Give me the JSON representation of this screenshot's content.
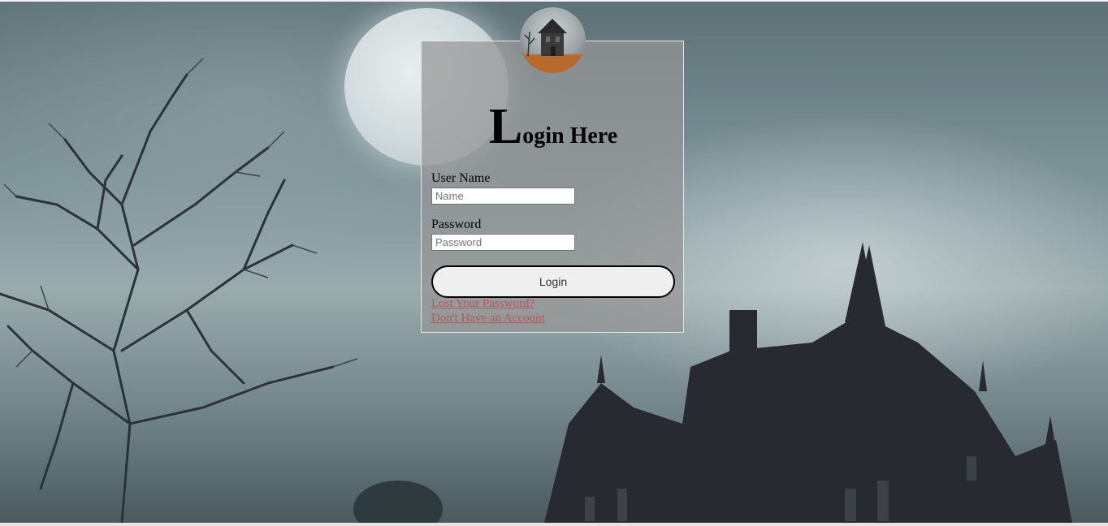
{
  "page": {
    "title_first_letter": "L",
    "title_rest": "ogin Here"
  },
  "form": {
    "username_label": "User Name",
    "username_placeholder": "Name",
    "username_value": "",
    "password_label": "Password",
    "password_placeholder": "Password",
    "password_value": "",
    "login_button_label": "Login",
    "lost_password_link": "Lost Your Password?",
    "no_account_link": "Don't Have an Account"
  },
  "icons": {
    "avatar": "haunted-house-avatar-icon"
  },
  "colors": {
    "panel_bg": "#969696",
    "link": "#c0525a",
    "button_bg": "#efefef",
    "button_border": "#000000"
  }
}
